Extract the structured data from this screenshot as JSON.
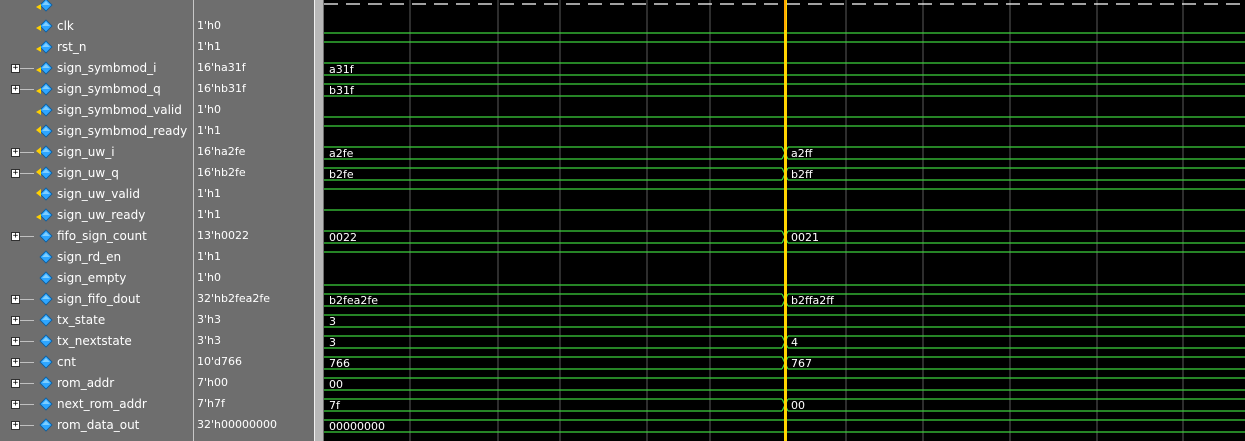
{
  "signals": [
    {
      "name": "",
      "value": "",
      "expand": false,
      "dir": "in",
      "type": "bit",
      "segments": [],
      "hi": false
    },
    {
      "name": "clk",
      "value": "1'h0",
      "expand": false,
      "dir": "in",
      "type": "bit",
      "hi": false,
      "segments": []
    },
    {
      "name": "rst_n",
      "value": "1'h1",
      "expand": false,
      "dir": "in",
      "type": "bit",
      "hi": true,
      "segments": []
    },
    {
      "name": "sign_symbmod_i",
      "value": "16'ha31f",
      "expand": true,
      "dir": "in",
      "type": "bus",
      "segments": [
        {
          "label": "a31f"
        }
      ]
    },
    {
      "name": "sign_symbmod_q",
      "value": "16'hb31f",
      "expand": true,
      "dir": "in",
      "type": "bus",
      "segments": [
        {
          "label": "b31f"
        }
      ]
    },
    {
      "name": "sign_symbmod_valid",
      "value": "1'h0",
      "expand": false,
      "dir": "in",
      "type": "bit",
      "hi": false,
      "segments": []
    },
    {
      "name": "sign_symbmod_ready",
      "value": "1'h1",
      "expand": false,
      "dir": "out",
      "type": "bit",
      "hi": true,
      "segments": []
    },
    {
      "name": "sign_uw_i",
      "value": "16'ha2fe",
      "expand": true,
      "dir": "out",
      "type": "bus",
      "segments": [
        {
          "label": "a2fe"
        },
        {
          "label": "a2ff"
        }
      ]
    },
    {
      "name": "sign_uw_q",
      "value": "16'hb2fe",
      "expand": true,
      "dir": "out",
      "type": "bus",
      "segments": [
        {
          "label": "b2fe"
        },
        {
          "label": "b2ff"
        }
      ]
    },
    {
      "name": "sign_uw_valid",
      "value": "1'h1",
      "expand": false,
      "dir": "out",
      "type": "bit",
      "hi": true,
      "segments": []
    },
    {
      "name": "sign_uw_ready",
      "value": "1'h1",
      "expand": false,
      "dir": "in",
      "type": "bit",
      "hi": true,
      "segments": []
    },
    {
      "name": "fifo_sign_count",
      "value": "13'h0022",
      "expand": true,
      "dir": "int",
      "type": "bus",
      "segments": [
        {
          "label": "0022"
        },
        {
          "label": "0021"
        }
      ]
    },
    {
      "name": "sign_rd_en",
      "value": "1'h1",
      "expand": false,
      "dir": "int",
      "type": "bit",
      "hi": true,
      "segments": []
    },
    {
      "name": "sign_empty",
      "value": "1'h0",
      "expand": false,
      "dir": "int",
      "type": "bit",
      "hi": false,
      "segments": []
    },
    {
      "name": "sign_fifo_dout",
      "value": "32'hb2fea2fe",
      "expand": true,
      "dir": "int",
      "type": "bus",
      "segments": [
        {
          "label": "b2fea2fe"
        },
        {
          "label": "b2ffa2ff"
        }
      ]
    },
    {
      "name": "tx_state",
      "value": "3'h3",
      "expand": true,
      "dir": "int",
      "type": "bus",
      "segments": [
        {
          "label": "3"
        }
      ]
    },
    {
      "name": "tx_nextstate",
      "value": "3'h3",
      "expand": true,
      "dir": "int",
      "type": "bus",
      "segments": [
        {
          "label": "3"
        },
        {
          "label": "4"
        }
      ]
    },
    {
      "name": "cnt",
      "value": "10'd766",
      "expand": true,
      "dir": "int",
      "type": "bus",
      "segments": [
        {
          "label": "766"
        },
        {
          "label": "767"
        }
      ]
    },
    {
      "name": "rom_addr",
      "value": "7'h00",
      "expand": true,
      "dir": "int",
      "type": "bus",
      "segments": [
        {
          "label": "00"
        }
      ]
    },
    {
      "name": "next_rom_addr",
      "value": "7'h7f",
      "expand": true,
      "dir": "int",
      "type": "bus",
      "segments": [
        {
          "label": "7f"
        },
        {
          "label": "00"
        }
      ]
    },
    {
      "name": "rom_data_out",
      "value": "32'h00000000",
      "expand": true,
      "dir": "int",
      "type": "bus",
      "segments": [
        {
          "label": "00000000"
        }
      ]
    }
  ],
  "colors": {
    "wave": "#3cd23c",
    "grid": "#5a5a5a",
    "cursor": "#ffd400",
    "pane_bg": "#6e6e6e",
    "icon_in": "#2ea6ff",
    "icon_arrow": "#ffd000"
  },
  "icons": {
    "expand": "plus-box-icon",
    "signal": "diamond-signal-icon"
  }
}
